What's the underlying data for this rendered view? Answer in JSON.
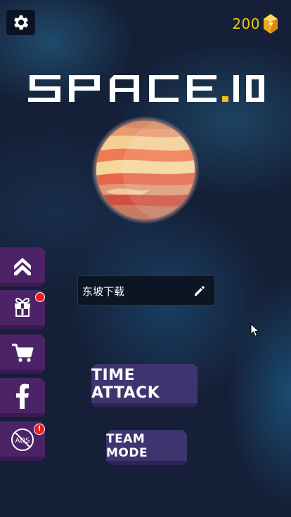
{
  "topbar": {
    "settings_icon": "gear-icon",
    "coins": "200",
    "coin_icon": "crystal-coin-icon"
  },
  "logo": {
    "text_main": "SPACE",
    "text_dot": ".",
    "text_suffix": "IO",
    "dot_color": "#f2c218"
  },
  "sidebar": {
    "items": [
      {
        "name": "upgrade",
        "icon": "double-chevron-up-icon",
        "badge": ""
      },
      {
        "name": "gift",
        "icon": "gift-icon",
        "badge": "dot"
      },
      {
        "name": "shop",
        "icon": "cart-icon",
        "badge": ""
      },
      {
        "name": "facebook",
        "icon": "facebook-icon",
        "badge": ""
      },
      {
        "name": "no-ads",
        "icon": "no-ads-icon",
        "badge": "!",
        "icon_label": "ADS"
      }
    ]
  },
  "player": {
    "name": "东坡下载",
    "edit_icon": "pencil-icon"
  },
  "buttons": {
    "time_attack": "TIME ATTACK",
    "team_mode": "TEAM MODE"
  },
  "colors": {
    "background": "#152038",
    "side_button": "#4b2366",
    "mode_button": "#3e3570",
    "accent_gold": "#f2c218",
    "badge_red": "#e5201e"
  }
}
